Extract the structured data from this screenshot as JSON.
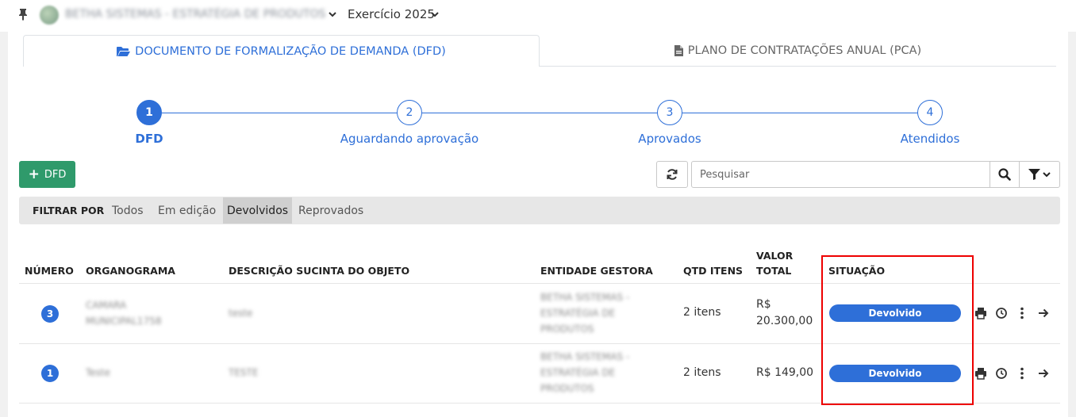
{
  "topbar": {
    "org_name": "BETHA SISTEMAS - ESTRATÉGIA DE PRODUTOS",
    "exercicio": "Exercício 2025"
  },
  "tabs": [
    {
      "label": "DOCUMENTO DE FORMALIZAÇÃO DE DEMANDA (DFD)",
      "icon": "folder-open-icon",
      "active": true
    },
    {
      "label": "PLANO DE CONTRATAÇÕES ANUAL (PCA)",
      "icon": "file-icon",
      "active": false
    }
  ],
  "steps": [
    {
      "number": "1",
      "label": "DFD",
      "active": true
    },
    {
      "number": "2",
      "label": "Aguardando aprovação",
      "active": false
    },
    {
      "number": "3",
      "label": "Aprovados",
      "active": false
    },
    {
      "number": "4",
      "label": "Atendidos",
      "active": false
    }
  ],
  "toolbar": {
    "add_label": "DFD",
    "search_placeholder": "Pesquisar"
  },
  "filters": {
    "title": "FILTRAR POR",
    "options": [
      "Todos",
      "Em edição",
      "Devolvidos",
      "Reprovados"
    ],
    "selected": "Devolvidos"
  },
  "table": {
    "headers": {
      "numero": "NÚMERO",
      "organograma": "ORGANOGRAMA",
      "descricao": "DESCRIÇÃO SUCINTA DO OBJETO",
      "entidade": "ENTIDADE GESTORA",
      "qtd": "QTD ITENS",
      "valor_1": "VALOR",
      "valor_2": "TOTAL",
      "situacao": "SITUAÇÃO"
    },
    "rows": [
      {
        "numero": "3",
        "organograma_1": "CAMARA",
        "organograma_2": "MUNICIPAL1758",
        "descricao": "teste",
        "entidade_1": "BETHA SISTEMAS -",
        "entidade_2": "ESTRATÉGIA DE",
        "entidade_3": "PRODUTOS",
        "qtd": "2 itens",
        "valor_1": "R$",
        "valor_2": "20.300,00",
        "situacao": "Devolvido"
      },
      {
        "numero": "1",
        "organograma_1": "Teste",
        "organograma_2": "",
        "descricao": "TESTE",
        "entidade_1": "BETHA SISTEMAS -",
        "entidade_2": "ESTRATÉGIA DE",
        "entidade_3": "PRODUTOS",
        "qtd": "2 itens",
        "valor_1": "R$ 149,00",
        "valor_2": "",
        "situacao": "Devolvido"
      }
    ]
  },
  "colors": {
    "accent": "#2e6fd8",
    "add_button": "#2f9a6b",
    "highlight": "#ee0000"
  }
}
